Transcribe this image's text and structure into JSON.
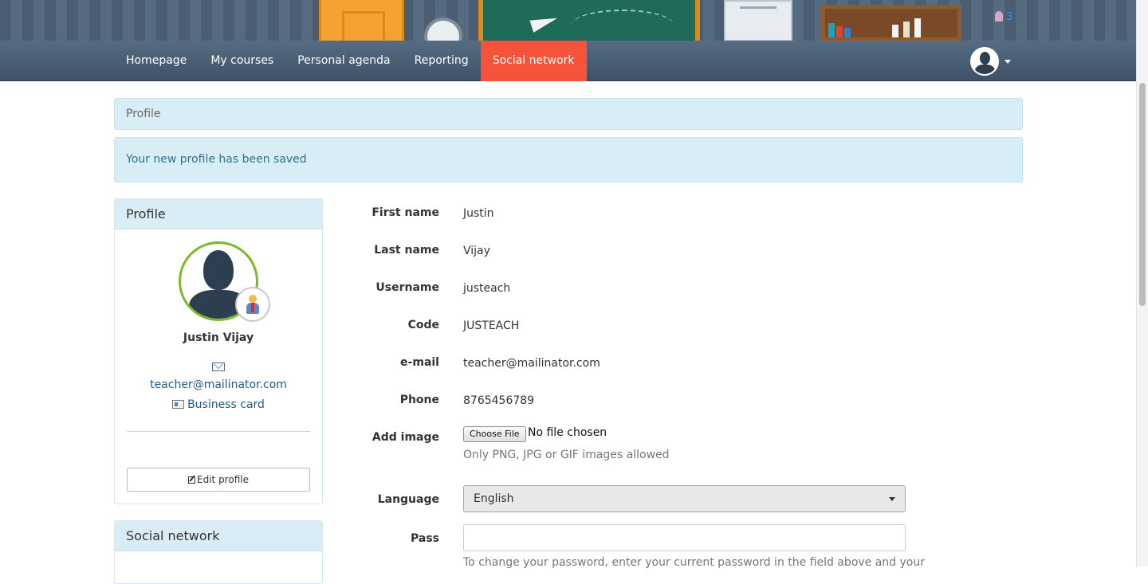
{
  "header": {
    "online_count": "3"
  },
  "navbar": {
    "items": [
      {
        "label": "Homepage"
      },
      {
        "label": "My courses"
      },
      {
        "label": "Personal agenda"
      },
      {
        "label": "Reporting"
      },
      {
        "label": "Social network",
        "active": true
      }
    ]
  },
  "breadcrumb": {
    "label": "Profile"
  },
  "alert": {
    "message": "Your new profile has been saved"
  },
  "sidebar": {
    "profile_panel": {
      "title": "Profile",
      "name": "Justin Vijay",
      "email": "teacher@mailinator.com",
      "business_card": "Business card",
      "edit_button": "Edit profile"
    },
    "social_panel": {
      "title": "Social network"
    }
  },
  "form": {
    "first_name": {
      "label": "First name",
      "value": "Justin"
    },
    "last_name": {
      "label": "Last name",
      "value": "Vijay"
    },
    "username": {
      "label": "Username",
      "value": "justeach"
    },
    "code": {
      "label": "Code",
      "value": "JUSTEACH"
    },
    "email": {
      "label": "e-mail",
      "value": "teacher@mailinator.com"
    },
    "phone": {
      "label": "Phone",
      "value": "8765456789"
    },
    "add_image": {
      "label": "Add image",
      "button": "Choose File",
      "status": "No file chosen",
      "help": "Only PNG, JPG or GIF images allowed"
    },
    "language": {
      "label": "Language",
      "selected": "English"
    },
    "pass": {
      "label": "Pass",
      "value": "",
      "help": "To change your password, enter your current password in the field above and your"
    }
  },
  "colors": {
    "nav_active": "#f5543b",
    "panel_heading": "#d9edf7",
    "link": "#1e5c8c",
    "avatar_ring": "#7ab929"
  },
  "icons": [
    "user-online-icon",
    "user-avatar-icon",
    "caret-down-icon",
    "teacher-badge-icon",
    "mail-icon",
    "business-card-icon",
    "edit-icon",
    "select-caret-icon"
  ]
}
